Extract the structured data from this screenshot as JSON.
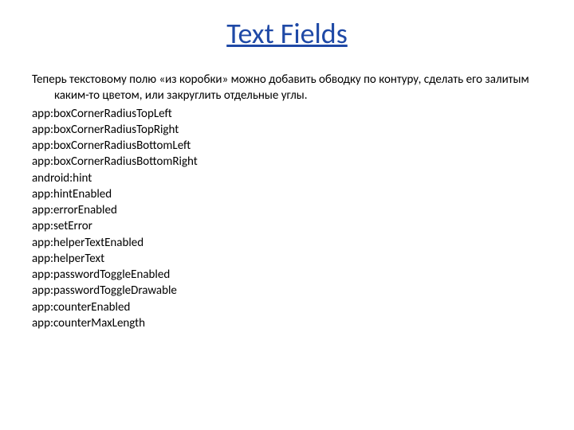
{
  "title": "Text Fields",
  "title_href": "#",
  "intro": "Теперь текстовому полю «из коробки» можно добавить обводку по контуру, сделать его залитым каким-то цветом, или закруглить отдельные углы.",
  "attributes": [
    "app:boxCornerRadiusTopLeft",
    "app:boxCornerRadiusTopRight",
    "app:boxCornerRadiusBottomLeft",
    "app:boxCornerRadiusBottomRight",
    "android:hint",
    "app:hintEnabled",
    "app:errorEnabled",
    "app:setError",
    "app:helperTextEnabled",
    "app:helperText",
    "app:passwordToggleEnabled",
    "app:passwordToggleDrawable",
    "app:counterEnabled",
    "app:counterMaxLength"
  ]
}
